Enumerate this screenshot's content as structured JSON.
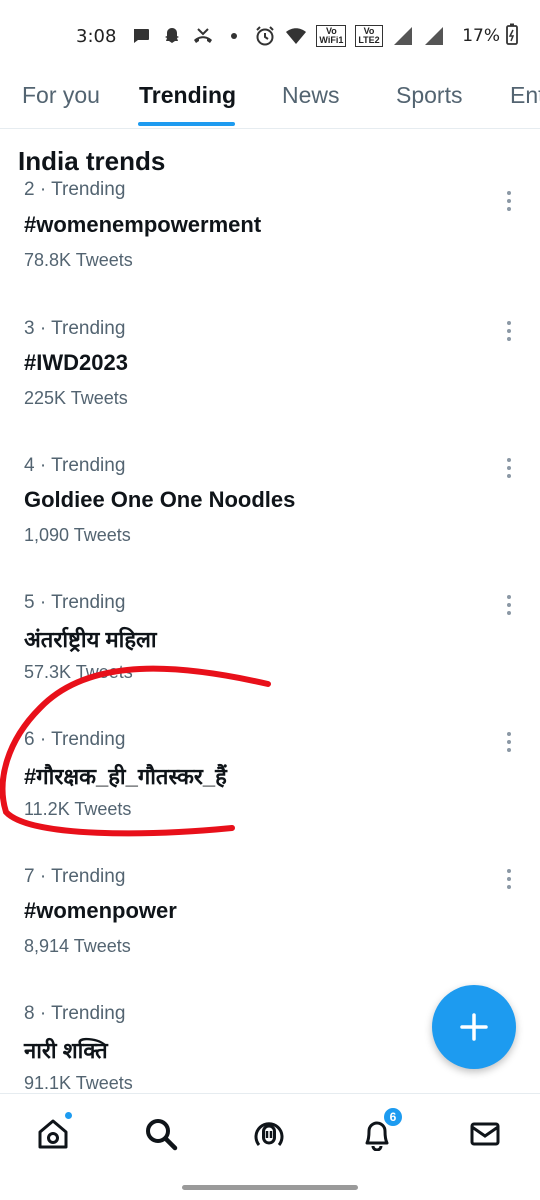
{
  "status_bar": {
    "time": "3:08",
    "wifi_tag_top": "Vo",
    "wifi_tag_bottom": "WiFi1",
    "lte_tag_top": "Vo",
    "lte_tag_bottom": "LTE2",
    "battery": "17%",
    "icons": [
      "messages-icon",
      "snapchat-icon",
      "missed-call-icon",
      "dot-icon",
      "alarm-icon",
      "wifi-icon",
      "signal-icon",
      "signal-icon",
      "battery-icon"
    ]
  },
  "tabs": [
    {
      "label": "For you",
      "active": false
    },
    {
      "label": "Trending",
      "active": true
    },
    {
      "label": "News",
      "active": false
    },
    {
      "label": "Sports",
      "active": false
    },
    {
      "label": "Ent",
      "active": false
    }
  ],
  "page_title": "India trends",
  "trends": [
    {
      "meta": "2 · Trending",
      "name": "#womenempowerment",
      "count": "78.8K Tweets"
    },
    {
      "meta": "3 · Trending",
      "name": "#IWD2023",
      "count": "225K Tweets"
    },
    {
      "meta": "4 · Trending",
      "name": "Goldiee One One Noodles",
      "count": "1,090 Tweets"
    },
    {
      "meta": "5 · Trending",
      "name": "अंतर्राष्ट्रीय महिला",
      "count": "57.3K Tweets"
    },
    {
      "meta": "6 · Trending",
      "name": "#गौरक्षक_ही_गौतस्कर_हैं",
      "count": "11.2K Tweets"
    },
    {
      "meta": "7 · Trending",
      "name": "#womenpower",
      "count": "8,914 Tweets"
    },
    {
      "meta": "8 · Trending",
      "name": "नारी शक्ति",
      "count": "91.1K Tweets"
    }
  ],
  "notifications_badge": "6",
  "colors": {
    "accent": "#1d9bf0",
    "text_primary": "#0f1419",
    "text_secondary": "#536471",
    "annotation": "#e8101a"
  }
}
